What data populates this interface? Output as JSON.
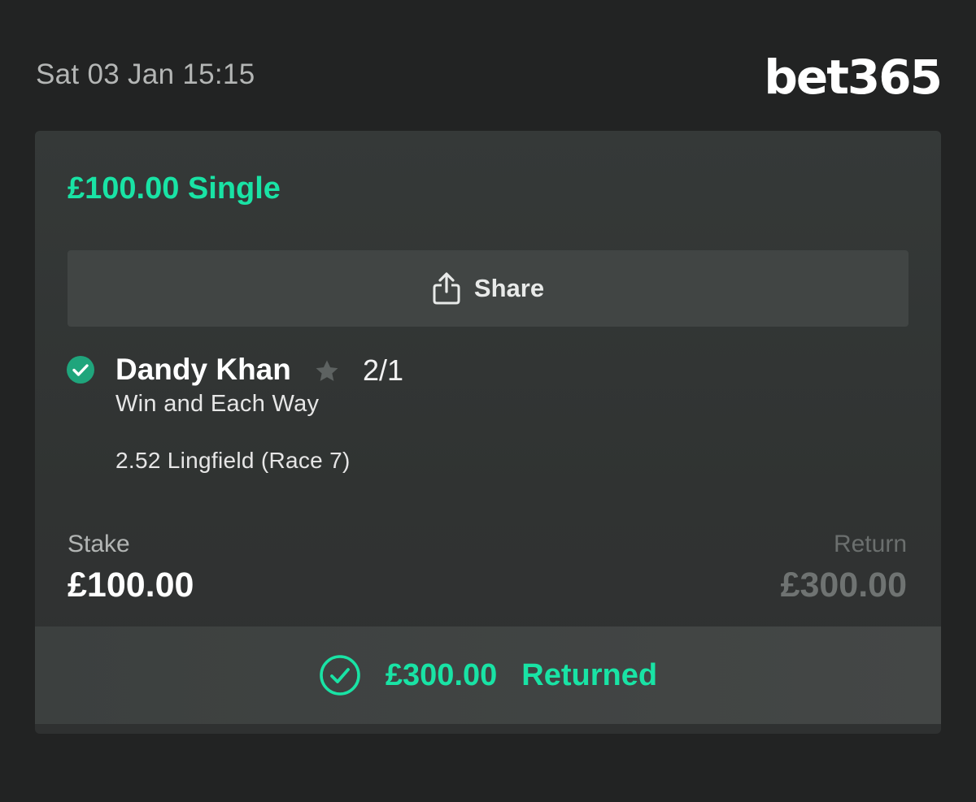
{
  "header": {
    "date": "Sat 03 Jan 15:15",
    "logo": "bet365"
  },
  "bet": {
    "title": "£100.00 Single",
    "share_label": "Share",
    "selection": {
      "name": "Dandy Khan",
      "odds": "2/1",
      "market": "Win and Each Way",
      "event": "2.52 Lingfield (Race 7)",
      "status_icon": "check-circle-icon",
      "favourite_icon": "star-icon"
    },
    "stake_label": "Stake",
    "stake_value": "£100.00",
    "return_label": "Return",
    "return_value": "£300.00",
    "returned_amount": "£300.00",
    "returned_label": "Returned"
  },
  "colors": {
    "accent": "#19e3a5",
    "background": "#222323",
    "card": "#333736"
  }
}
